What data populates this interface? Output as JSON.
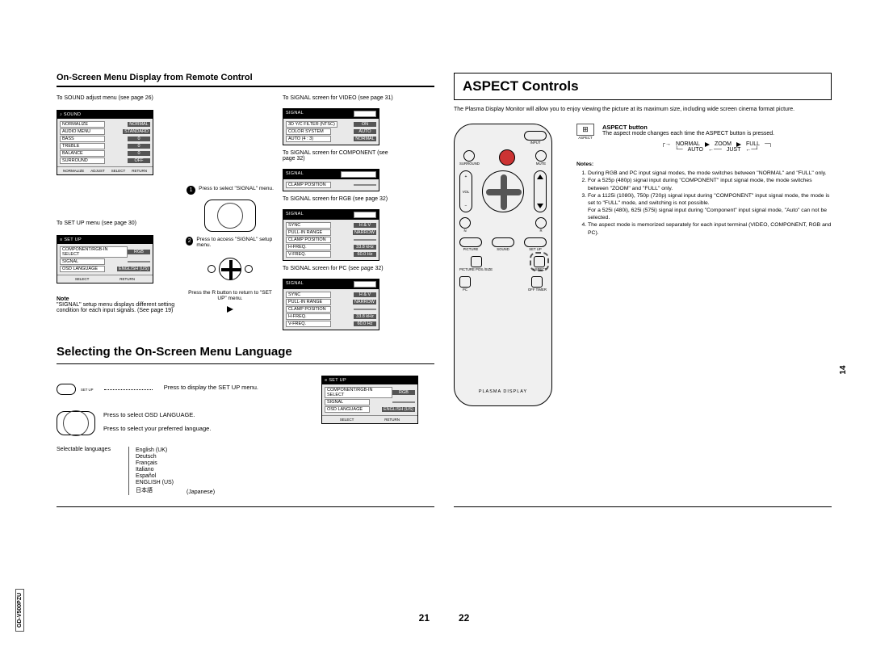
{
  "model_tag": "GD-V500PZU",
  "side_page": "14",
  "page21": {
    "subtitle": "On-Screen Menu Display from Remote Control",
    "sound_caption": "To SOUND adjust menu (see page 26)",
    "setup_caption": "To SET UP menu (see page 30)",
    "sound_menu": {
      "title": "SOUND",
      "rows": [
        {
          "l": "NORMALIZE",
          "v": "NORMAL"
        },
        {
          "l": "AUDIO MENU",
          "v": "STANDARD"
        },
        {
          "l": "BASS",
          "v": "0"
        },
        {
          "l": "TREBLE",
          "v": "0"
        },
        {
          "l": "BALANCE",
          "v": "0"
        },
        {
          "l": "SURROUND",
          "v": "OFF"
        }
      ],
      "foot": [
        "NORMALIZE",
        "ADJUST",
        "SELECT",
        "RETURN"
      ]
    },
    "setup_menu": {
      "title": "SET UP",
      "rows": [
        {
          "l": "COMPONENT/RGB-IN SELECT",
          "v": "RGB"
        },
        {
          "l": "SIGNAL",
          "v": ""
        },
        {
          "l": "OSD LANGUAGE",
          "v": "ENGLISH (US)"
        }
      ],
      "foot": [
        "SELECT",
        "RETURN"
      ]
    },
    "arrow_steps": {
      "s1": "Press to select \"SIGNAL\" menu.",
      "s2": "Press to access \"SIGNAL\" setup menu.",
      "r": "Press the R button to return to \"SET UP\" menu."
    },
    "note_label": "Note",
    "note_text": "\"SIGNAL\" setup menu displays different setting condition for each input signals. (See page 19)",
    "sig_video_cap": "To SIGNAL screen for VIDEO (see page 31)",
    "sig_comp_cap": "To SIGNAL screen for COMPONENT (see page 32)",
    "sig_rgb_cap": "To SIGNAL screen for RGB (see page 32)",
    "sig_pc_cap": "To SIGNAL screen for PC (see page 32)",
    "sig_video": {
      "title": "SIGNAL",
      "tag": "VIDEO",
      "rows": [
        {
          "l": "3D Y/C FILTER (NTSC)",
          "v": "ON"
        },
        {
          "l": "COLOR SYSTEM",
          "v": "AUTO"
        },
        {
          "l": "AUTO (4 : 3)",
          "v": "NORMAL"
        }
      ]
    },
    "sig_comp": {
      "title": "SIGNAL",
      "tag": "COMPONENT",
      "rows": [
        {
          "l": "CLAMP POSITION",
          "v": ""
        }
      ]
    },
    "sig_rgb": {
      "title": "SIGNAL",
      "tag": "RGB",
      "rows": [
        {
          "l": "SYNC",
          "v": "H & V"
        },
        {
          "l": "PULL-IN RANGE",
          "v": "NARROW"
        },
        {
          "l": "CLAMP POSITION",
          "v": ""
        },
        {
          "l": "H-FREQ.",
          "v": "33.8 kHz"
        },
        {
          "l": "V-FREQ.",
          "v": "60.0 Hz"
        }
      ]
    },
    "sig_pc": {
      "title": "SIGNAL",
      "tag": "PC",
      "rows": [
        {
          "l": "SYNC",
          "v": "H & V"
        },
        {
          "l": "PULL-IN RANGE",
          "v": "NARROW"
        },
        {
          "l": "CLAMP POSITION",
          "v": ""
        },
        {
          "l": "H-FREQ.",
          "v": "33.8 kHz"
        },
        {
          "l": "V-FREQ.",
          "v": "60.0 Hz"
        }
      ]
    },
    "section2": "Selecting the On-Screen Menu Language",
    "step1_lbl": "SET UP",
    "step1": "Press to display the SET UP menu.",
    "step2": "Press to select OSD LANGUAGE.",
    "step3": "Press to select your preferred language.",
    "langs_label": "Selectable languages",
    "langs": [
      "English (UK)",
      "Deutsch",
      "Français",
      "Italiano",
      "Español",
      "ENGLISH (US)",
      "日本語"
    ],
    "jp_note": "(Japanese)",
    "lang_menu": {
      "title": "SET UP",
      "rows": [
        {
          "l": "COMPONENT/RGB-IN SELECT",
          "v": "RGB"
        },
        {
          "l": "SIGNAL",
          "v": ""
        },
        {
          "l": "OSD LANGUAGE",
          "v": "ENGLISH (US)"
        }
      ],
      "foot": [
        "SELECT",
        "RETURN"
      ]
    },
    "pnum": "21"
  },
  "page22": {
    "title": "ASPECT Controls",
    "intro": "The Plasma Display Monitor will allow you to enjoy viewing the picture at its maximum size, including wide screen cinema format picture.",
    "remote": {
      "brand": "PLASMA DISPLAY",
      "labels": {
        "input": "INPUT",
        "mute": "MUTE",
        "surround": "SURROUND",
        "vol": "VOL",
        "picture": "PICTURE",
        "sound": "SOUND",
        "setup": "SET UP",
        "picpos": "PICTURE POS./SIZE",
        "aspect": "ASPECT",
        "pc": "PC",
        "offtimer": "OFF TIMER",
        "r": "R",
        "n": "N"
      }
    },
    "aspect_icon": "ASPECT",
    "aspect_hdr": "ASPECT button",
    "aspect_desc": "The aspect mode changes each time the ASPECT button is pressed.",
    "flow": {
      "a": "NORMAL",
      "b": "ZOOM",
      "c": "FULL",
      "d": "AUTO",
      "e": "JUST"
    },
    "notes_hdr": "Notes:",
    "notes": [
      "During RGB and PC input signal modes, the mode switches between \"NORMAL\" and \"FULL\" only.",
      "For a 525p (480p) signal input during \"COMPONENT\" input signal mode, the mode switches between \"ZOOM\" and \"FULL\" only.",
      "For a 1125i (1080i), 750p (720p) signal input during \"COMPONENT\" input signal mode, the mode is set to \"FULL\" mode, and switching is not possible.\nFor a 525i (480i), 625i (575i) signal input during \"Component\" input signal mode, \"Auto\" can not be selected.",
      "The aspect mode is memorized separately for each input terminal (VIDEO, COMPONENT, RGB and PC)."
    ],
    "pnum": "22"
  }
}
